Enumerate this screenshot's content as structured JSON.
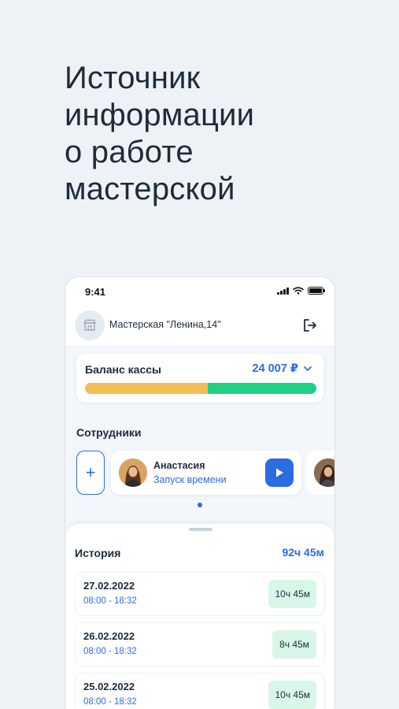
{
  "headline": [
    "Источник",
    "информации",
    "о работе",
    "мастерской"
  ],
  "status_bar": {
    "time": "9:41"
  },
  "app_bar": {
    "workshop_name": "Мастерская \"Ленина,14\"",
    "shop_icon": "store-icon",
    "logout_icon": "logout-icon"
  },
  "balance": {
    "label": "Баланс кассы",
    "amount": "24 007 ₽",
    "chevron_icon": "chevron-down-icon",
    "bar_fill_fraction": 0.53,
    "colors": {
      "segment_a": "#f3bd56",
      "segment_b": "#1fd184"
    }
  },
  "employees": {
    "title": "Сотрудники",
    "add_label": "+",
    "items": [
      {
        "name": "Анастасия",
        "action": "Запуск времени"
      }
    ],
    "page_indicator": {
      "current": 1
    }
  },
  "history": {
    "title": "История",
    "total": "92ч 45м",
    "rows": [
      {
        "date": "27.02.2022",
        "time": "08:00 - 18:32",
        "duration": "10ч 45м"
      },
      {
        "date": "26.02.2022",
        "time": "08:00 - 18:32",
        "duration": "8ч 45м"
      },
      {
        "date": "25.02.2022",
        "time": "08:00 - 18:32",
        "duration": "10ч 45м"
      }
    ]
  },
  "colors": {
    "accent": "#2d6be0",
    "background": "#eef2f7",
    "badge": "#d8f7e8"
  }
}
